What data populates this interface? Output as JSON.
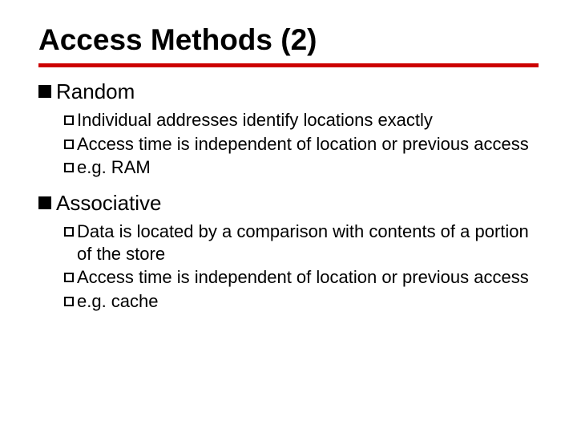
{
  "title": "Access Methods (2)",
  "sections": [
    {
      "heading": "Random",
      "items": [
        "Individual addresses identify locations exactly",
        "Access time is independent of location or previous access",
        "e.g. RAM"
      ]
    },
    {
      "heading": "Associative",
      "items": [
        "Data is located by a comparison with contents of a portion of the store",
        "Access time is independent of location or previous access",
        "e.g. cache"
      ]
    }
  ]
}
